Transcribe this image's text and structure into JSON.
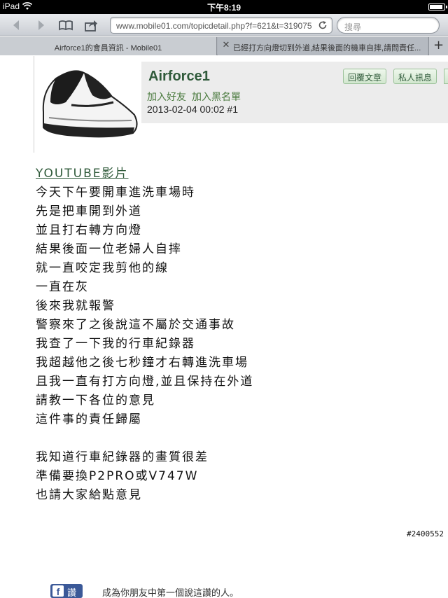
{
  "status_bar": {
    "carrier": "iPad",
    "time": "下午8:19"
  },
  "browser": {
    "url": "www.mobile01.com/topicdetail.php?f=621&t=319075",
    "search_placeholder": "搜尋",
    "tabs": [
      {
        "title": "Airforce1的會員資訊 - Mobile01",
        "active": true
      },
      {
        "title": "已經打方向燈切到外道,結果後面的機車自摔,請問責任...",
        "active": false
      }
    ],
    "add_tab": "+"
  },
  "post": {
    "author": "Airforce1",
    "add_friend": "加入好友",
    "add_blacklist": "加入黑名單",
    "timestamp": "2013-02-04 00:02 #1",
    "reply_button": "回覆文章",
    "pm_button": "私人訊息",
    "youtube_link": "YOUTUBE影片",
    "lines": [
      "今天下午要開車進洗車場時",
      "先是把車開到外道",
      "並且打右轉方向燈",
      "結果後面一位老婦人自摔",
      "就一直咬定我剪他的線",
      "一直在灰",
      "後來我就報警",
      "警察來了之後說這不屬於交通事故",
      "我查了一下我的行車紀錄器",
      "我超越他之後七秒鐘才右轉進洗車場",
      "且我一直有打方向燈,並且保持在外道",
      "請教一下各位的意見",
      "這件事的責任歸屬"
    ],
    "lines_2": [
      "我知道行車紀錄器的畫質很差",
      "準備要換P2PRO或V747W",
      "也請大家給點意見"
    ]
  },
  "facebook": {
    "icon_letter": "f",
    "button_label": "讚",
    "note": "成為你朋友中第一個說這讚的人。"
  },
  "watermark": "#2400552"
}
